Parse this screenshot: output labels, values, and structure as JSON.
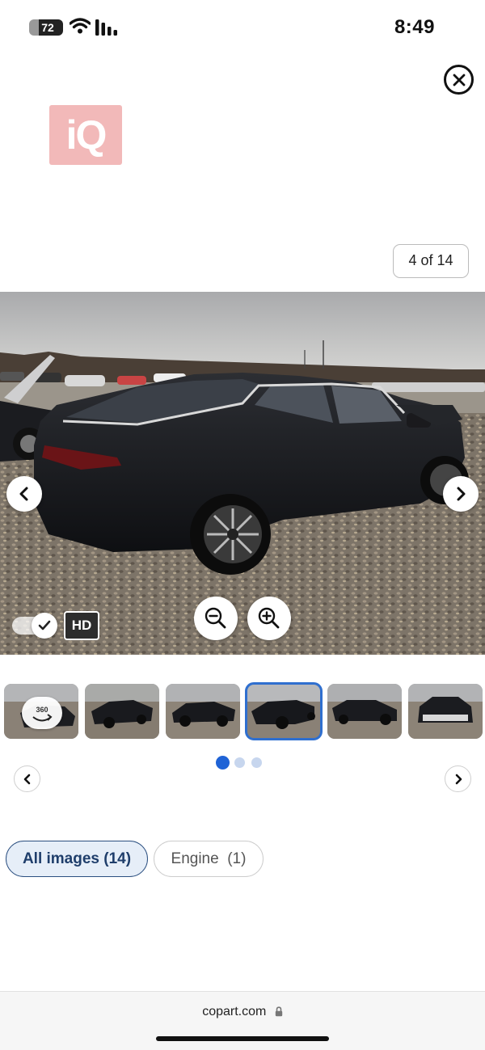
{
  "status_bar": {
    "battery": "72",
    "time": "8:49",
    "icons": [
      "wifi-icon",
      "cellular-signal-icon"
    ]
  },
  "header": {
    "close_icon": "close-icon",
    "logo_text": "iQ"
  },
  "gallery": {
    "counter": "4 of 14",
    "current_index": 4,
    "total": 14,
    "hd_label": "HD",
    "hd_enabled": true,
    "badge_360": "360",
    "controls": [
      "chevron-left-icon",
      "chevron-right-icon",
      "zoom-out-icon",
      "zoom-in-icon"
    ],
    "thumbnails": [
      {
        "id": "thumb-1",
        "active": false
      },
      {
        "id": "thumb-2",
        "active": false
      },
      {
        "id": "thumb-3",
        "active": false
      },
      {
        "id": "thumb-4",
        "active": true
      },
      {
        "id": "thumb-5",
        "active": false
      },
      {
        "id": "thumb-6",
        "active": false
      }
    ],
    "page_dots": {
      "count": 3,
      "active": 0
    }
  },
  "filters": {
    "all_images": "All images (14)",
    "engine": "Engine  (1)"
  },
  "browser": {
    "url": "copart.com"
  },
  "colors": {
    "accent_blue": "#2f6fcf",
    "pill_active_bg": "#e6eef8",
    "pill_active_text": "#1f3e6b",
    "logo_pink": "#f2b9b9"
  }
}
